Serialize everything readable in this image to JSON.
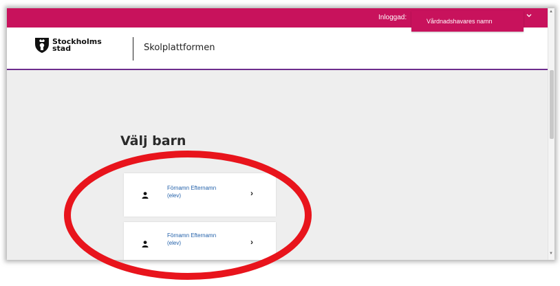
{
  "topbar": {
    "logged_in_label": "Inloggad:",
    "user_name": "Vårdnadshavares namn",
    "dropdown_icon": "chevron-down-icon",
    "color": "#c8125c"
  },
  "header": {
    "logo_line1": "Stockholms",
    "logo_line2": "stad",
    "platform_name": "Skolplattformen",
    "accent_color": "#6d2c8d"
  },
  "main": {
    "title": "Välj barn",
    "children": [
      {
        "name": "Förnamn Efternamn",
        "role": "(elev)",
        "icon": "person-icon",
        "chevron": "›"
      },
      {
        "name": "Förnamn Efternamn",
        "role": "(elev)",
        "icon": "person-icon",
        "chevron": "›"
      }
    ]
  },
  "annotation": {
    "shape": "ellipse",
    "color": "#e8141c"
  }
}
